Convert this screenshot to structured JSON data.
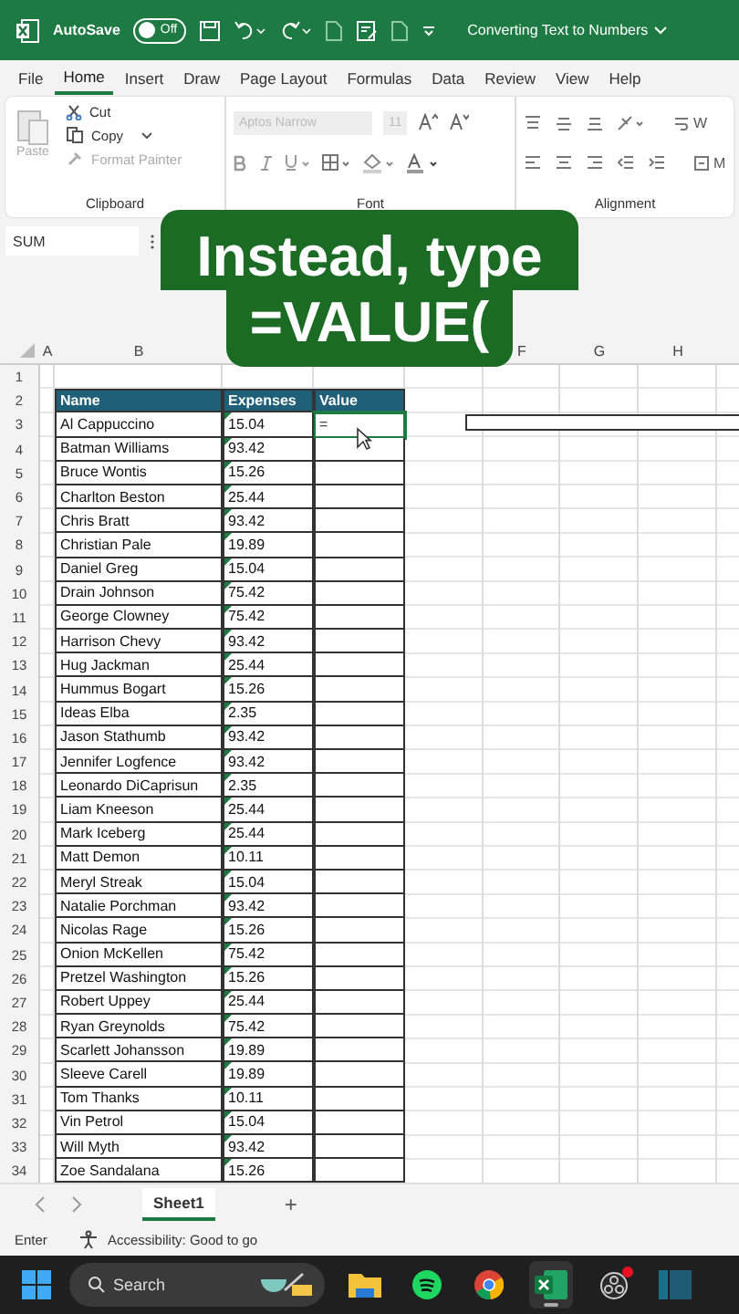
{
  "title_bar": {
    "autosave_label": "AutoSave",
    "autosave_toggle": {
      "label": "Off",
      "on": false
    },
    "document_title": "Converting Text to Numbers"
  },
  "menu_tabs": [
    {
      "label": "File",
      "selected": false
    },
    {
      "label": "Home",
      "selected": true
    },
    {
      "label": "Insert",
      "selected": false
    },
    {
      "label": "Draw",
      "selected": false
    },
    {
      "label": "Page Layout",
      "selected": false
    },
    {
      "label": "Formulas",
      "selected": false
    },
    {
      "label": "Data",
      "selected": false
    },
    {
      "label": "Review",
      "selected": false
    },
    {
      "label": "View",
      "selected": false
    },
    {
      "label": "Help",
      "selected": false
    }
  ],
  "ribbon": {
    "clipboard": {
      "label": "Clipboard",
      "paste": {
        "label": "Paste",
        "disabled": true
      },
      "cut": {
        "label": "Cut",
        "disabled": false
      },
      "copy": {
        "label": "Copy",
        "disabled": false
      },
      "format_painter": {
        "label": "Format Painter",
        "disabled": true
      }
    },
    "font": {
      "label": "Font",
      "font_name": "Aptos Narrow",
      "font_size": "11",
      "disabled": true
    },
    "alignment": {
      "label": "Alignment",
      "wrap_fragment": "W",
      "merge_fragment": "M"
    }
  },
  "name_box": "SUM",
  "caption": [
    "Instead, type",
    "=VALUE("
  ],
  "column_headers": [
    "A",
    "B",
    "F",
    "G",
    "H"
  ],
  "rows": [
    {
      "num": "1",
      "kind": "blank"
    },
    {
      "num": "2",
      "kind": "header",
      "cells": [
        "Name",
        "Expenses",
        "Value"
      ]
    },
    {
      "num": "3",
      "kind": "data",
      "name": "Al Cappuccino",
      "expense": "15.04",
      "value": "=",
      "selected": true,
      "flagged": true
    },
    {
      "num": "4",
      "kind": "data",
      "name": "Batman Williams",
      "expense": "93.42",
      "selected": false,
      "flagged": true
    },
    {
      "num": "5",
      "kind": "data",
      "name": "Bruce Wontis",
      "expense": "15.26",
      "selected": false,
      "flagged": true
    },
    {
      "num": "6",
      "kind": "data",
      "name": "Charlton Beston",
      "expense": "25.44",
      "selected": false,
      "flagged": true
    },
    {
      "num": "7",
      "kind": "data",
      "name": "Chris Bratt",
      "expense": "93.42",
      "selected": false,
      "flagged": true
    },
    {
      "num": "8",
      "kind": "data",
      "name": "Christian Pale",
      "expense": "19.89",
      "selected": false,
      "flagged": true
    },
    {
      "num": "9",
      "kind": "data",
      "name": "Daniel Greg",
      "expense": "15.04",
      "selected": false,
      "flagged": true
    },
    {
      "num": "10",
      "kind": "data",
      "name": "Drain Johnson",
      "expense": "75.42",
      "selected": false,
      "flagged": true
    },
    {
      "num": "11",
      "kind": "data",
      "name": "George Clowney",
      "expense": "75.42",
      "selected": false,
      "flagged": true
    },
    {
      "num": "12",
      "kind": "data",
      "name": "Harrison Chevy",
      "expense": "93.42",
      "selected": false,
      "flagged": true
    },
    {
      "num": "13",
      "kind": "data",
      "name": "Hug Jackman",
      "expense": "25.44",
      "selected": false,
      "flagged": true
    },
    {
      "num": "14",
      "kind": "data",
      "name": "Hummus Bogart",
      "expense": "15.26",
      "selected": false,
      "flagged": true
    },
    {
      "num": "15",
      "kind": "data",
      "name": "Ideas Elba",
      "expense": "2.35",
      "selected": false,
      "flagged": true
    },
    {
      "num": "16",
      "kind": "data",
      "name": "Jason Stathumb",
      "expense": "93.42",
      "selected": false,
      "flagged": true
    },
    {
      "num": "17",
      "kind": "data",
      "name": "Jennifer Logfence",
      "expense": "93.42",
      "selected": false,
      "flagged": true
    },
    {
      "num": "18",
      "kind": "data",
      "name": "Leonardo DiCaprisun",
      "expense": "2.35",
      "selected": false,
      "flagged": true
    },
    {
      "num": "19",
      "kind": "data",
      "name": "Liam Kneeson",
      "expense": "25.44",
      "selected": false,
      "flagged": true
    },
    {
      "num": "20",
      "kind": "data",
      "name": "Mark Iceberg",
      "expense": "25.44",
      "selected": false,
      "flagged": true
    },
    {
      "num": "21",
      "kind": "data",
      "name": "Matt Demon",
      "expense": "10.11",
      "selected": false,
      "flagged": true
    },
    {
      "num": "22",
      "kind": "data",
      "name": "Meryl Streak",
      "expense": "15.04",
      "selected": false,
      "flagged": true
    },
    {
      "num": "23",
      "kind": "data",
      "name": "Natalie Porchman",
      "expense": "93.42",
      "selected": false,
      "flagged": true
    },
    {
      "num": "24",
      "kind": "data",
      "name": "Nicolas Rage",
      "expense": "15.26",
      "selected": false,
      "flagged": true
    },
    {
      "num": "25",
      "kind": "data",
      "name": "Onion McKellen",
      "expense": "75.42",
      "selected": false,
      "flagged": true
    },
    {
      "num": "26",
      "kind": "data",
      "name": "Pretzel Washington",
      "expense": "15.26",
      "selected": false,
      "flagged": true
    },
    {
      "num": "27",
      "kind": "data",
      "name": "Robert Uppey",
      "expense": "25.44",
      "selected": false,
      "flagged": true
    },
    {
      "num": "28",
      "kind": "data",
      "name": "Ryan Greynolds",
      "expense": "75.42",
      "selected": false,
      "flagged": true
    },
    {
      "num": "29",
      "kind": "data",
      "name": "Scarlett Johansson",
      "expense": "19.89",
      "selected": false,
      "flagged": true
    },
    {
      "num": "30",
      "kind": "data",
      "name": "Sleeve Carell",
      "expense": "19.89",
      "selected": false,
      "flagged": true
    },
    {
      "num": "31",
      "kind": "data",
      "name": "Tom Thanks",
      "expense": "10.11",
      "selected": false,
      "flagged": true
    },
    {
      "num": "32",
      "kind": "data",
      "name": "Vin Petrol",
      "expense": "15.04",
      "selected": false,
      "flagged": true
    },
    {
      "num": "33",
      "kind": "data",
      "name": "Will Myth",
      "expense": "93.42",
      "selected": false,
      "flagged": true
    },
    {
      "num": "34",
      "kind": "data",
      "name": "Zoe Sandalana",
      "expense": "15.26",
      "selected": false,
      "flagged": true
    }
  ],
  "sheet_tabs": [
    {
      "label": "Sheet1",
      "selected": true
    }
  ],
  "add_sheet": "+",
  "status_bar": {
    "mode": "Enter",
    "accessibility": "Accessibility: Good to go"
  },
  "taskbar": {
    "search_placeholder": "Search",
    "apps": [
      {
        "kind": "folder",
        "active": false
      },
      {
        "kind": "music",
        "active": false
      },
      {
        "kind": "browser",
        "active": false
      },
      {
        "kind": "spreadsheet",
        "active": true
      },
      {
        "kind": "recorder",
        "active": false,
        "badge": true
      },
      {
        "kind": "panel",
        "active": false
      }
    ]
  }
}
